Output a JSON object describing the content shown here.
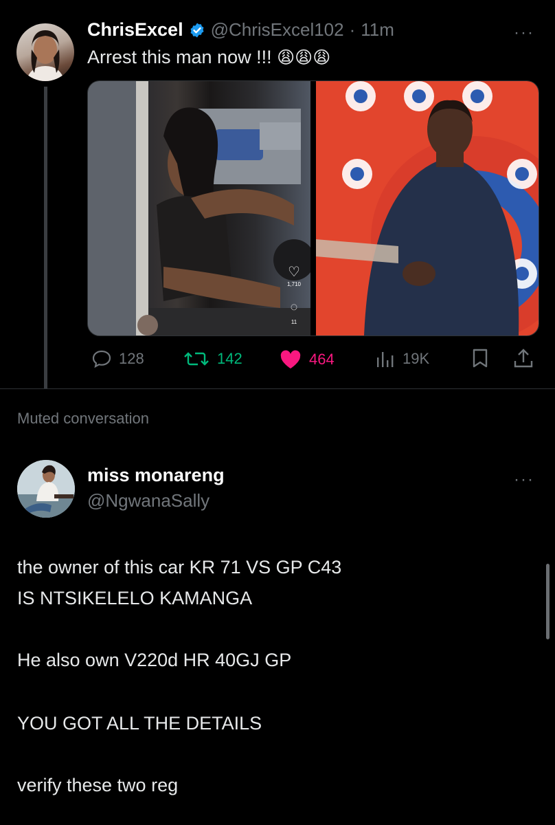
{
  "tweet": {
    "display_name": "ChrisExcel",
    "handle": "@ChrisExcel102",
    "separator": "·",
    "time": "11m",
    "text": "Arrest this man now !!!",
    "emoji": "😩😩😩",
    "more": "···",
    "media_left": {
      "likes": "1,710",
      "comments": "11"
    },
    "stats": {
      "replies": "128",
      "retweets": "142",
      "likes": "464",
      "views": "19K"
    }
  },
  "muted_label": "Muted conversation",
  "reply": {
    "display_name": "miss monareng",
    "handle": "@NgwanaSally",
    "more": "···",
    "lines": [
      "the owner of this car KR 71 VS GP C43",
      "IS NTSIKELELO KAMANGA",
      "He also own V220d HR 40GJ GP",
      "YOU GOT ALL THE DETAILS",
      "verify these two reg"
    ]
  },
  "colors": {
    "background": "#000000",
    "text": "#e7e9ea",
    "muted_text": "#71767b",
    "verified": "#1d9bf0",
    "retweet": "#00ba7c",
    "like": "#f91880"
  },
  "icons": [
    "verified-badge-icon",
    "more-icon",
    "reply-icon",
    "retweet-icon",
    "heart-icon",
    "views-icon",
    "bookmark-icon",
    "share-icon"
  ]
}
